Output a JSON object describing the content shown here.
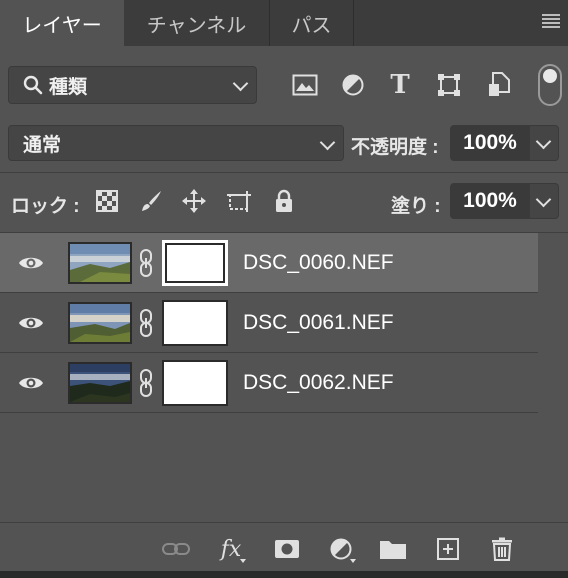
{
  "tabs": [
    {
      "label": "レイヤー",
      "active": true
    },
    {
      "label": "チャンネル",
      "active": false
    },
    {
      "label": "パス",
      "active": false
    }
  ],
  "filter": {
    "kind_label": "種類",
    "icons": [
      "image-filter-icon",
      "adjustment-filter-icon",
      "type-filter-icon",
      "shape-filter-icon",
      "smart-object-filter-icon"
    ]
  },
  "type_icon_glyph": "T",
  "blend": {
    "mode": "通常",
    "opacity_label": "不透明度 :",
    "opacity_value": "100%"
  },
  "lock": {
    "label": "ロック :",
    "icons": [
      "lock-transparent-pixels-icon",
      "lock-image-pixels-icon",
      "lock-position-icon",
      "lock-artboard-icon",
      "lock-all-icon"
    ],
    "fill_label": "塗り :",
    "fill_value": "100%"
  },
  "layers": [
    {
      "name": "DSC_0060.NEF",
      "visible": true,
      "selected": true
    },
    {
      "name": "DSC_0061.NEF",
      "visible": true,
      "selected": false
    },
    {
      "name": "DSC_0062.NEF",
      "visible": true,
      "selected": false
    }
  ],
  "bottom": {
    "fx_label": "fx",
    "icons": [
      "link-layers-icon",
      "fx-icon",
      "add-mask-icon",
      "adjustment-layer-icon",
      "new-group-icon",
      "new-layer-icon",
      "delete-layer-icon"
    ]
  },
  "colors": {
    "panel": "#535353",
    "tab_bar": "#3c3c3c",
    "selected_row": "#696969",
    "field": "#3a3a3a"
  }
}
